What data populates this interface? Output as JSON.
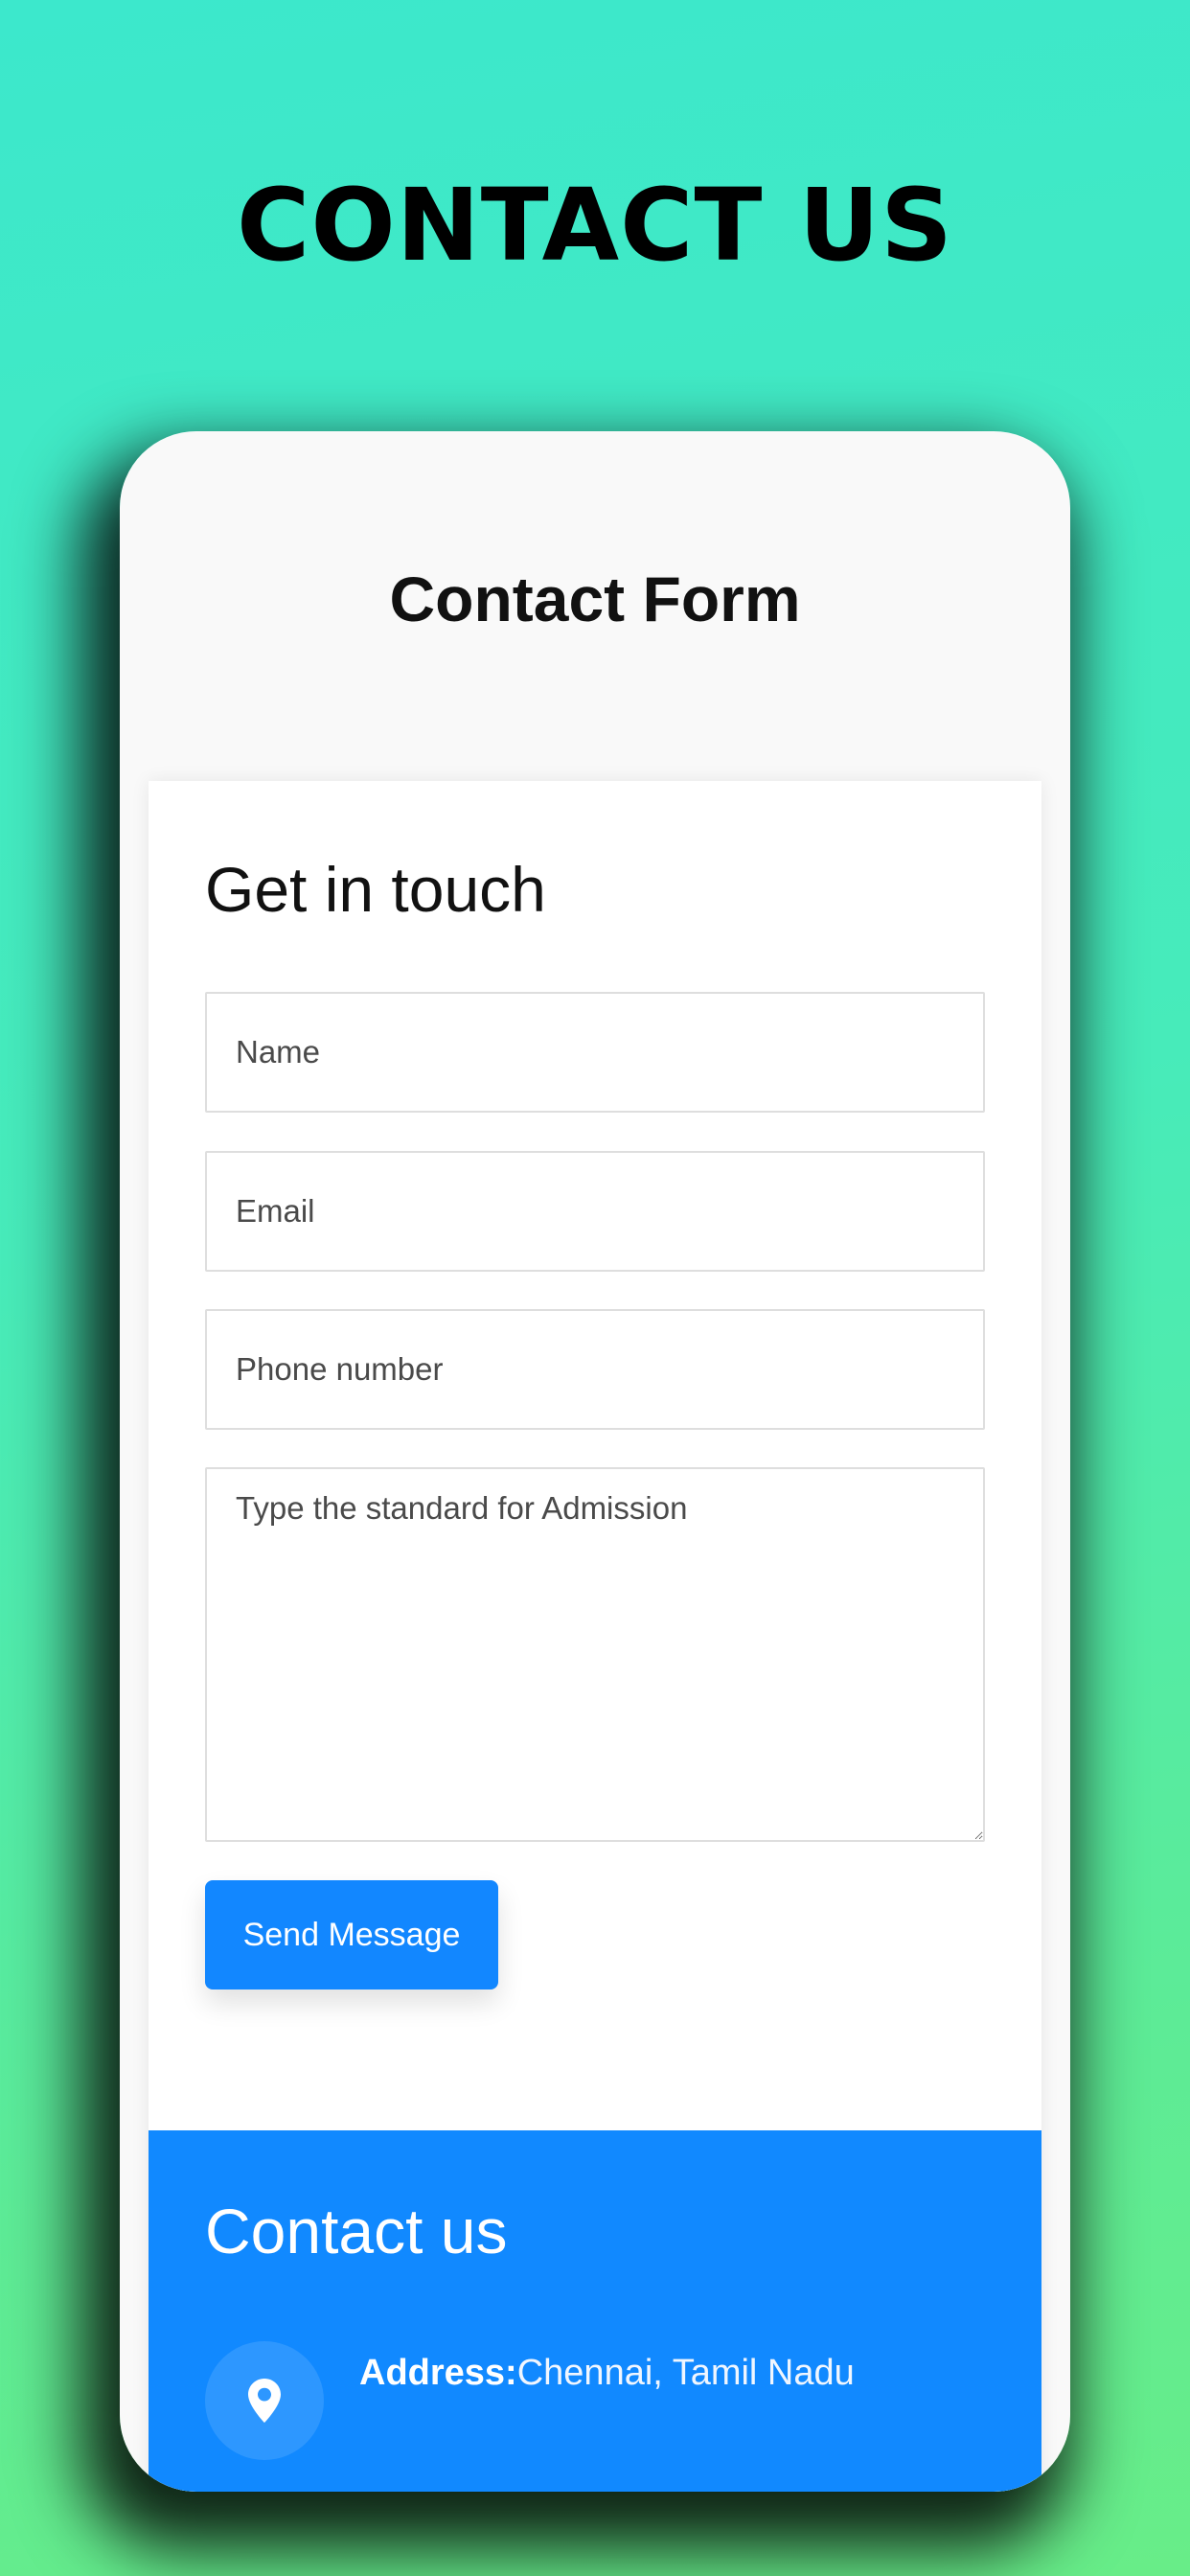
{
  "page": {
    "heading": "CONTACT US"
  },
  "app": {
    "title": "Contact Form"
  },
  "form": {
    "heading": "Get in touch",
    "name_placeholder": "Name",
    "email_placeholder": "Email",
    "phone_placeholder": "Phone number",
    "message_placeholder": "Type the standard for Admission",
    "send_label": "Send Message"
  },
  "contact": {
    "heading": "Contact us",
    "address_label": "Address:",
    "address_value": "Chennai, Tamil Nadu",
    "address_icon": "map-pin-icon"
  },
  "colors": {
    "accent": "#1189ff",
    "background_gradient_start": "#3ce8cc",
    "background_gradient_end": "#68ed88"
  }
}
